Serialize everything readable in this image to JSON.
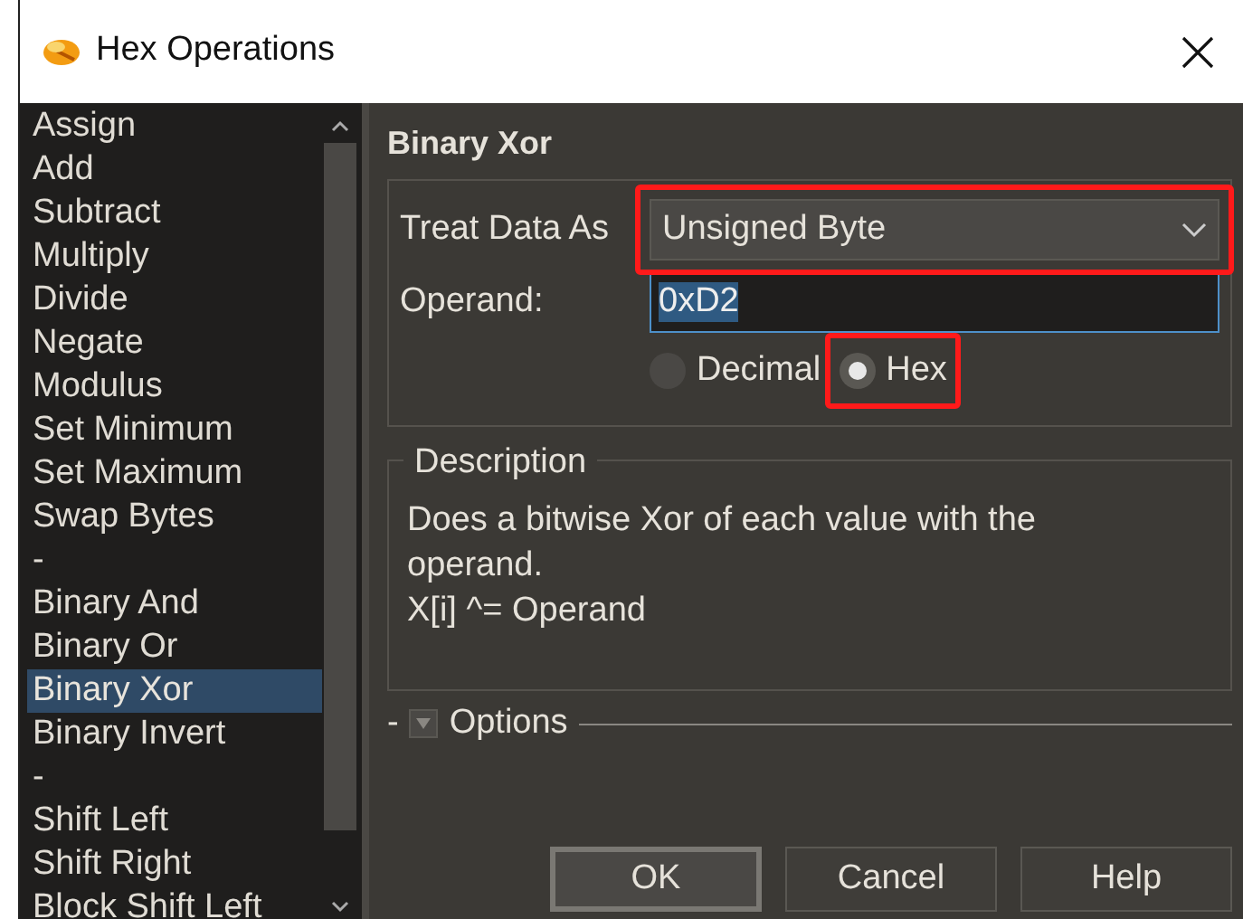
{
  "window": {
    "title": "Hex Operations"
  },
  "operations": [
    {
      "label": "Assign",
      "selected": false
    },
    {
      "label": "Add",
      "selected": false
    },
    {
      "label": "Subtract",
      "selected": false
    },
    {
      "label": "Multiply",
      "selected": false
    },
    {
      "label": "Divide",
      "selected": false
    },
    {
      "label": "Negate",
      "selected": false
    },
    {
      "label": "Modulus",
      "selected": false
    },
    {
      "label": "Set Minimum",
      "selected": false
    },
    {
      "label": "Set Maximum",
      "selected": false
    },
    {
      "label": "Swap Bytes",
      "selected": false
    },
    {
      "label": "-",
      "selected": false
    },
    {
      "label": "Binary And",
      "selected": false
    },
    {
      "label": "Binary Or",
      "selected": false
    },
    {
      "label": "Binary Xor",
      "selected": true
    },
    {
      "label": "Binary Invert",
      "selected": false
    },
    {
      "label": "-",
      "selected": false
    },
    {
      "label": "Shift Left",
      "selected": false
    },
    {
      "label": "Shift Right",
      "selected": false
    },
    {
      "label": "Block Shift Left",
      "selected": false
    }
  ],
  "panel": {
    "title": "Binary Xor",
    "treat_data_as": {
      "label": "Treat Data As",
      "value": "Unsigned Byte",
      "highlighted": true
    },
    "operand": {
      "label": "Operand:",
      "value": "0xD2"
    },
    "formats": [
      {
        "label": "Decimal",
        "selected": false
      },
      {
        "label": "Hex",
        "selected": true,
        "highlighted": true
      }
    ],
    "description": {
      "title": "Description",
      "lines": [
        "Does a bitwise Xor of each value with the operand.",
        "X[i] ^= Operand"
      ]
    },
    "options": {
      "prefix": "-",
      "label": "Options",
      "expanded": false
    }
  },
  "buttons": [
    "OK",
    "Cancel",
    "Help"
  ]
}
